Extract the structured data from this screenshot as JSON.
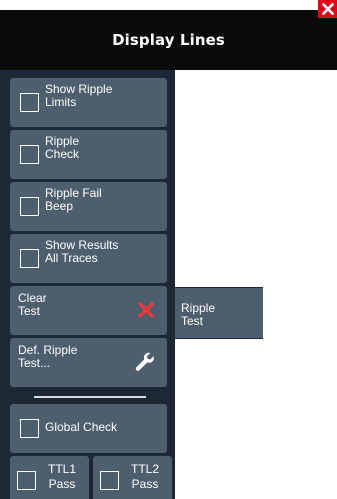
{
  "dialog": {
    "title": "Display Lines",
    "close_icon": "close-icon"
  },
  "colors": {
    "title_bar": "#0a0a0a",
    "panel": "#1c2833",
    "button": "#4d5f6e",
    "close": "#e10016",
    "clear_icon": "#ff3333"
  },
  "buttons": {
    "show_ripple_limits": {
      "label": "Show Ripple\nLimits",
      "checked": false
    },
    "ripple_check": {
      "label": "Ripple\nCheck",
      "checked": false
    },
    "ripple_fail_beep": {
      "label": "Ripple Fail\nBeep",
      "checked": false
    },
    "show_results_all_traces": {
      "label": "Show Results\nAll Traces",
      "checked": false
    },
    "clear_test": {
      "label": "Clear\nTest",
      "icon": "x-icon"
    },
    "def_ripple_test": {
      "label": "Def. Ripple\nTest...",
      "icon": "wrench-icon"
    },
    "global_check": {
      "label": "Global Check",
      "checked": false
    },
    "ttl1_pass": {
      "label": "TTL1\nPass",
      "checked": false
    },
    "ttl2_pass": {
      "label": "TTL2\nPass",
      "checked": false
    }
  },
  "submenu": {
    "ripple_test": {
      "label": "Ripple\nTest"
    }
  }
}
